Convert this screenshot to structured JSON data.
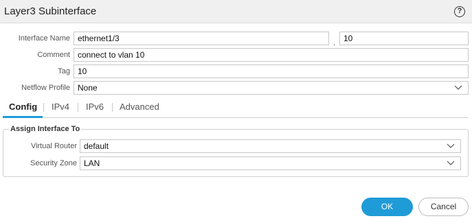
{
  "dialog": {
    "title": "Layer3 Subinterface",
    "help_icon": "help-circle-icon",
    "help_glyph": "?"
  },
  "form": {
    "interface_name": {
      "label": "Interface Name",
      "value": "ethernet1/3",
      "separator": ".",
      "suffix": "10"
    },
    "comment": {
      "label": "Comment",
      "value": "connect to  vlan 10"
    },
    "tag": {
      "label": "Tag",
      "value": "10"
    },
    "netflow_profile": {
      "label": "Netflow Profile",
      "value": "None"
    }
  },
  "tabs": [
    {
      "label": "Config",
      "active": true
    },
    {
      "label": "IPv4",
      "active": false
    },
    {
      "label": "IPv6",
      "active": false
    },
    {
      "label": "Advanced",
      "active": false
    }
  ],
  "assign": {
    "legend": "Assign Interface To",
    "virtual_router": {
      "label": "Virtual Router",
      "value": "default"
    },
    "security_zone": {
      "label": "Security Zone",
      "value": "LAN"
    }
  },
  "buttons": {
    "ok": "OK",
    "cancel": "Cancel"
  },
  "colors": {
    "accent": "#1f9bd7",
    "titlebar": "#f0f0f0",
    "border": "#c8c8c8"
  }
}
